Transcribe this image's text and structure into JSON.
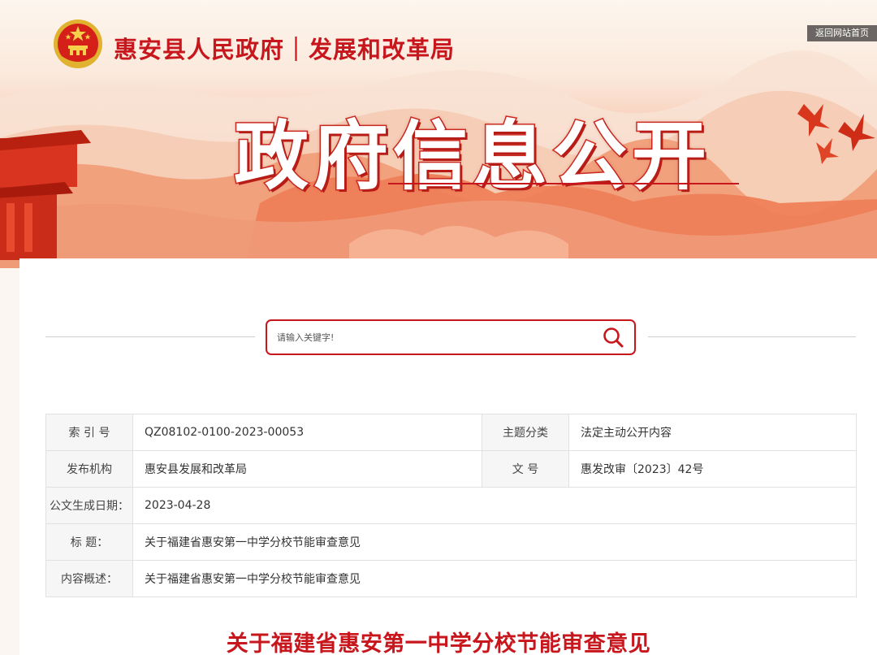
{
  "header": {
    "site_title": "惠安县人民政府｜发展和改革局",
    "home_link": "返回网站首页",
    "hero_title": "政府信息公开",
    "emblem_icon": "national-emblem-icon"
  },
  "search": {
    "placeholder": "请输入关键字!",
    "button_icon": "search-icon"
  },
  "info_table": {
    "index_label": "索 引 号",
    "index_value": "QZ08102-0100-2023-00053",
    "topic_label": "主题分类",
    "topic_value": "法定主动公开内容",
    "publisher_label": "发布机构",
    "publisher_value": "惠安县发展和改革局",
    "docno_label": "文 号",
    "docno_value": "惠发改审〔2023〕42号",
    "date_label": "公文生成日期：",
    "date_value": "2023-04-28",
    "title_label": "标 题：",
    "title_value": "关于福建省惠安第一中学分校节能审查意见",
    "summary_label": "内容概述：",
    "summary_value": "关于福建省惠安第一中学分校节能审查意见"
  },
  "document": {
    "title": "关于福建省惠安第一中学分校节能审查意见"
  },
  "colors": {
    "accent_red": "#c8161d",
    "home_link_bg": "#6b6663"
  }
}
